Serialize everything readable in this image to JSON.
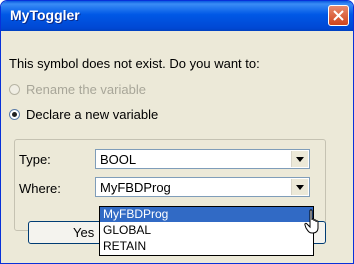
{
  "window": {
    "title": "MyToggler"
  },
  "dialog": {
    "question": "This symbol does not exist. Do you want to:",
    "options": [
      {
        "label": "Rename the variable",
        "checked": false,
        "disabled": true
      },
      {
        "label": "Declare a new variable",
        "checked": true,
        "disabled": false
      }
    ],
    "type_label": "Type:",
    "type_value": "BOOL",
    "where_label": "Where:",
    "where_value": "MyFBDProg",
    "ok_button_partial": "Yes"
  },
  "dropdown": {
    "items": [
      "MyFBDProg",
      "GLOBAL",
      "RETAIN"
    ],
    "selected_index": 0
  },
  "colors": {
    "title_bar": "#0058e6",
    "close_button": "#d1441c",
    "selection": "#316ac5"
  }
}
